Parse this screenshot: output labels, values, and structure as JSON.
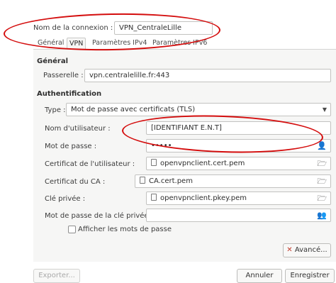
{
  "connection": {
    "name_label": "Nom de la connexion :",
    "name_value": "VPN_CentraleLille"
  },
  "tabs": [
    {
      "label": "Général"
    },
    {
      "label": "VPN"
    },
    {
      "label": "Paramètres IPv4"
    },
    {
      "label": "Paramètres IPv6"
    }
  ],
  "general": {
    "section_label": "Général",
    "gateway_label": "Passerelle :",
    "gateway_value": "vpn.centralelille.fr:443"
  },
  "auth": {
    "section_label": "Authentification",
    "type_label": "Type :",
    "type_value": "Mot de passe avec certificats (TLS)",
    "username_label": "Nom d'utilisateur :",
    "username_value": "[IDENTIFIANT E.N.T]",
    "password_label": "Mot de passe :",
    "password_value": "•••••",
    "user_cert_label": "Certificat de l'utilisateur :",
    "user_cert_value": "openvpnclient.cert.pem",
    "ca_cert_label": "Certificat du CA :",
    "ca_cert_value": "CA.cert.pem",
    "private_key_label": "Clé privée :",
    "private_key_value": "openvpnclient.pkey.pem",
    "key_password_label": "Mot de passe de la clé privée :",
    "key_password_value": "",
    "show_passwords_label": "Afficher les mots de passe"
  },
  "buttons": {
    "advanced": "Avancé...",
    "export": "Exporter...",
    "cancel": "Annuler",
    "save": "Enregistrer"
  },
  "icons": {
    "dropdown": "chevron-down-icon",
    "password_options": "user-key-icon",
    "file_chooser": "file-icon",
    "folder_open": "folder-open-icon",
    "advanced": "tools-icon"
  },
  "colors": {
    "annotation": "#d40d0d"
  }
}
